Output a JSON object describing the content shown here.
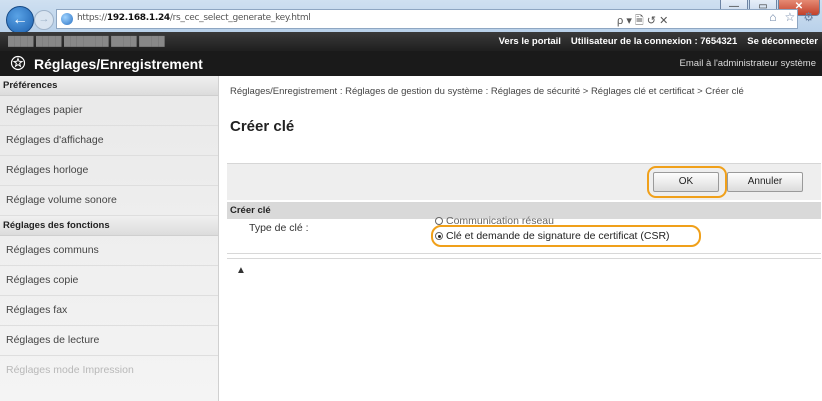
{
  "browser": {
    "url_prefix": "https://",
    "url_host": "192.168.1.24",
    "url_path": "/rs_cec_select_generate_key.html",
    "search_symbols": "ρ ▾ 🗎 ↺ ✕",
    "window_buttons": [
      "—",
      "▭",
      "✕"
    ]
  },
  "portal": {
    "device_text": "████ ████ ███████ ████ ████",
    "portal_link": "Vers le portail",
    "login_user": "Utilisateur de la connexion : 7654321",
    "logout": "Se déconnecter"
  },
  "header": {
    "title": "Réglages/Enregistrement",
    "email_admin": "Email à l'administrateur système"
  },
  "sidebar": {
    "sections": [
      {
        "title": "Préférences",
        "items": [
          "Réglages papier",
          "Réglages d'affichage",
          "Réglages horloge",
          "Réglage volume sonore"
        ]
      },
      {
        "title": "Réglages des fonctions",
        "items": [
          "Réglages communs",
          "Réglages copie",
          "Réglages fax",
          "Réglages de lecture",
          "Réglages mode Impression"
        ]
      }
    ]
  },
  "main": {
    "breadcrumb": "Réglages/Enregistrement : Réglages de gestion du système : Réglages de sécurité > Réglages clé et certificat > Créer clé",
    "page_title": "Créer clé",
    "ok_label": "OK",
    "cancel_label": "Annuler",
    "section_title": "Créer clé",
    "type_label": "Type de clé :",
    "option_1": "Communication réseau",
    "option_2": "Clé et demande de signature de certificat (CSR)",
    "top_anchor": "▲"
  }
}
